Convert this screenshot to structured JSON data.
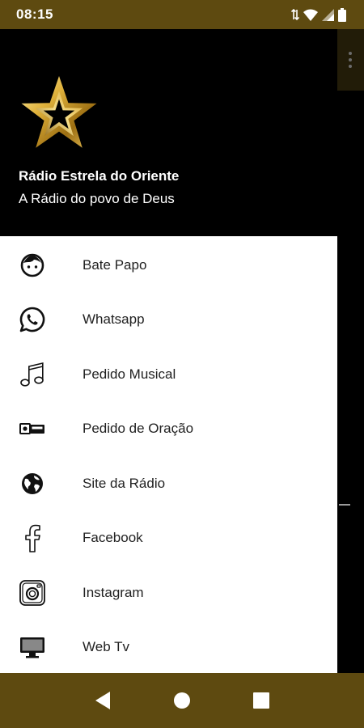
{
  "status_bar": {
    "time": "08:15",
    "icons": [
      "data-arrows-icon",
      "wifi-icon",
      "signal-icon",
      "battery-icon"
    ]
  },
  "header": {
    "logo": "gold-star-logo",
    "title": "Rádio Estrela do Oriente",
    "subtitle": "A Rádio do povo de Deus"
  },
  "menu": {
    "items": [
      {
        "label": "Bate Papo",
        "icon": "face-icon"
      },
      {
        "label": "Whatsapp",
        "icon": "whatsapp-icon"
      },
      {
        "label": "Pedido Musical",
        "icon": "music-note-icon"
      },
      {
        "label": "Pedido de Oração",
        "icon": "prayer-request-icon"
      },
      {
        "label": "Site da Rádio",
        "icon": "globe-icon"
      },
      {
        "label": "Facebook",
        "icon": "facebook-icon"
      },
      {
        "label": "Instagram",
        "icon": "instagram-icon"
      },
      {
        "label": "Web Tv",
        "icon": "tv-icon"
      }
    ]
  },
  "nav_bar": {
    "buttons": [
      "back-icon",
      "home-icon",
      "recents-icon"
    ]
  },
  "colors": {
    "bar_gold": "#5e4a10",
    "header_bg": "#000000",
    "drawer_bg": "#ffffff",
    "text_dark": "#212121"
  }
}
